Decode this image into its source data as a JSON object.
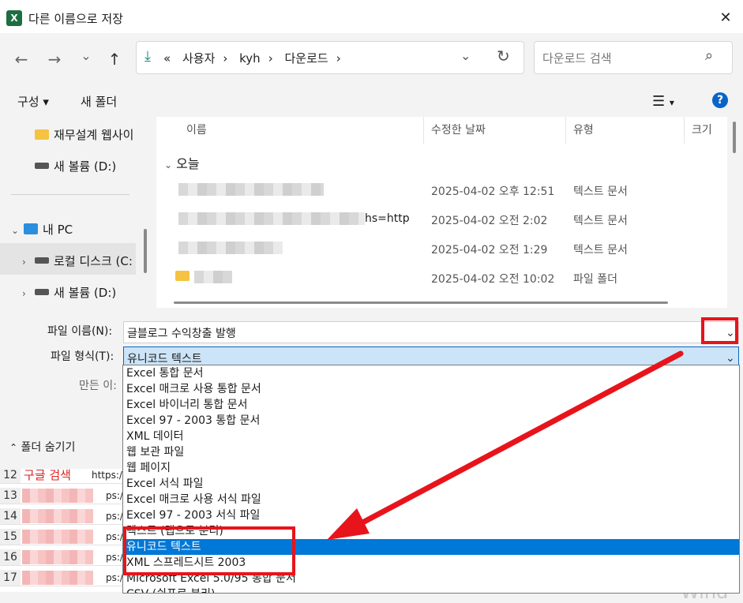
{
  "title": "다른 이름으로 저장",
  "nav_buttons": {
    "back": "←",
    "forward": "→",
    "recent": "⌄",
    "up": "↑"
  },
  "address": {
    "prefix": "«",
    "crumbs": [
      "사용자",
      "kyh",
      "다운로드"
    ]
  },
  "search": {
    "placeholder": "다운로드 검색"
  },
  "toolbar": {
    "organize": "구성 ▾",
    "new_folder": "새 폴더"
  },
  "nav": {
    "items": [
      {
        "label": "재무설계 웹사이"
      },
      {
        "label": "새 볼륨 (D:)"
      },
      {
        "label": "내 PC"
      },
      {
        "label": "로컬 디스크 (C:"
      },
      {
        "label": "새 볼륨 (D:)"
      }
    ]
  },
  "columns": [
    "이름",
    "수정한 날짜",
    "유형",
    "크기"
  ],
  "group_today": "오늘",
  "files": [
    {
      "name_visible": "",
      "date": "2025-04-02 오후 12:51",
      "type": "텍스트 문서"
    },
    {
      "name_visible": "hs=http",
      "date": "2025-04-02 오전 2:02",
      "type": "텍스트 문서"
    },
    {
      "name_visible": "",
      "date": "2025-04-02 오전 1:29",
      "type": "텍스트 문서"
    },
    {
      "name_visible": "",
      "date": "2025-04-02 오전 10:02",
      "type": "파일 폴더"
    }
  ],
  "form": {
    "filename_label": "파일 이름(N):",
    "filename_value": "글블로그 수익창출 발행",
    "filetype_label": "파일 형식(T):",
    "filetype_value": "유니코드 텍스트",
    "author_label": "만든 이:",
    "hide_folders": "폴더 숨기기"
  },
  "filetype_options": [
    "Excel 통합 문서",
    "Excel 매크로 사용 통합 문서",
    "Excel 바이너리 통합 문서",
    "Excel 97 - 2003 통합 문서",
    "XML 데이터",
    "웹 보관 파일",
    "웹 페이지",
    "Excel 서식 파일",
    "Excel 매크로 사용 서식 파일",
    "Excel 97 - 2003 서식 파일",
    "텍스트 (탭으로 분리)",
    "유니코드 텍스트",
    "XML 스프레드시트 2003",
    "Microsoft Excel 5.0/95 통합 문서",
    "CSV (쉼표로 분리)"
  ],
  "selected_option_index": 11,
  "sheet": {
    "rows": [
      "12",
      "13",
      "14",
      "15",
      "16",
      "17"
    ],
    "red_text": "구글 검색",
    "urls": [
      "https:/",
      "ps:/",
      "ps:/",
      "ps:/",
      "ps:/",
      "ps:/"
    ]
  },
  "windows_watermark": "Wind",
  "colors": {
    "accent": "#0078d7",
    "highlight": "#e8141b",
    "excel_green": "#1d6f42"
  }
}
